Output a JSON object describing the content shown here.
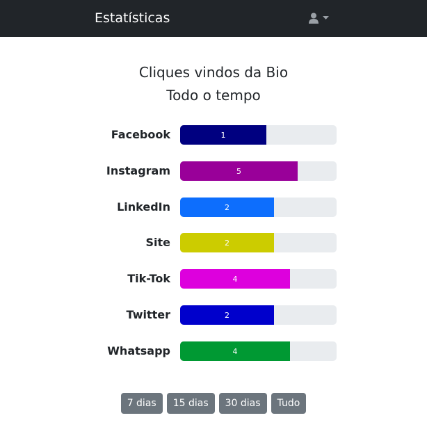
{
  "navbar": {
    "brand": "Estatísticas",
    "user_icon": "user-icon",
    "caret_icon": "caret-down-icon"
  },
  "title": {
    "line1": "Cliques vindos da Bio",
    "line2": "Todo o tempo"
  },
  "chart_data": {
    "type": "bar",
    "orientation": "horizontal",
    "categories": [
      "Facebook",
      "Instagram",
      "LinkedIn",
      "Site",
      "Tik-Tok",
      "Twitter",
      "Whatsapp"
    ],
    "values": [
      1,
      5,
      2,
      2,
      4,
      2,
      4
    ],
    "fill_fraction": [
      0.55,
      0.75,
      0.6,
      0.6,
      0.7,
      0.6,
      0.7
    ],
    "colors": [
      "#000080",
      "#990099",
      "#0d6efd",
      "#cccc00",
      "#dd00dd",
      "#0000cc",
      "#009933"
    ],
    "track_color": "#e9ecef"
  },
  "periods": [
    "7 dias",
    "15 dias",
    "30 dias",
    "Tudo"
  ],
  "colors": {
    "navbar_bg": "#212529",
    "button_bg": "#6c757d"
  }
}
